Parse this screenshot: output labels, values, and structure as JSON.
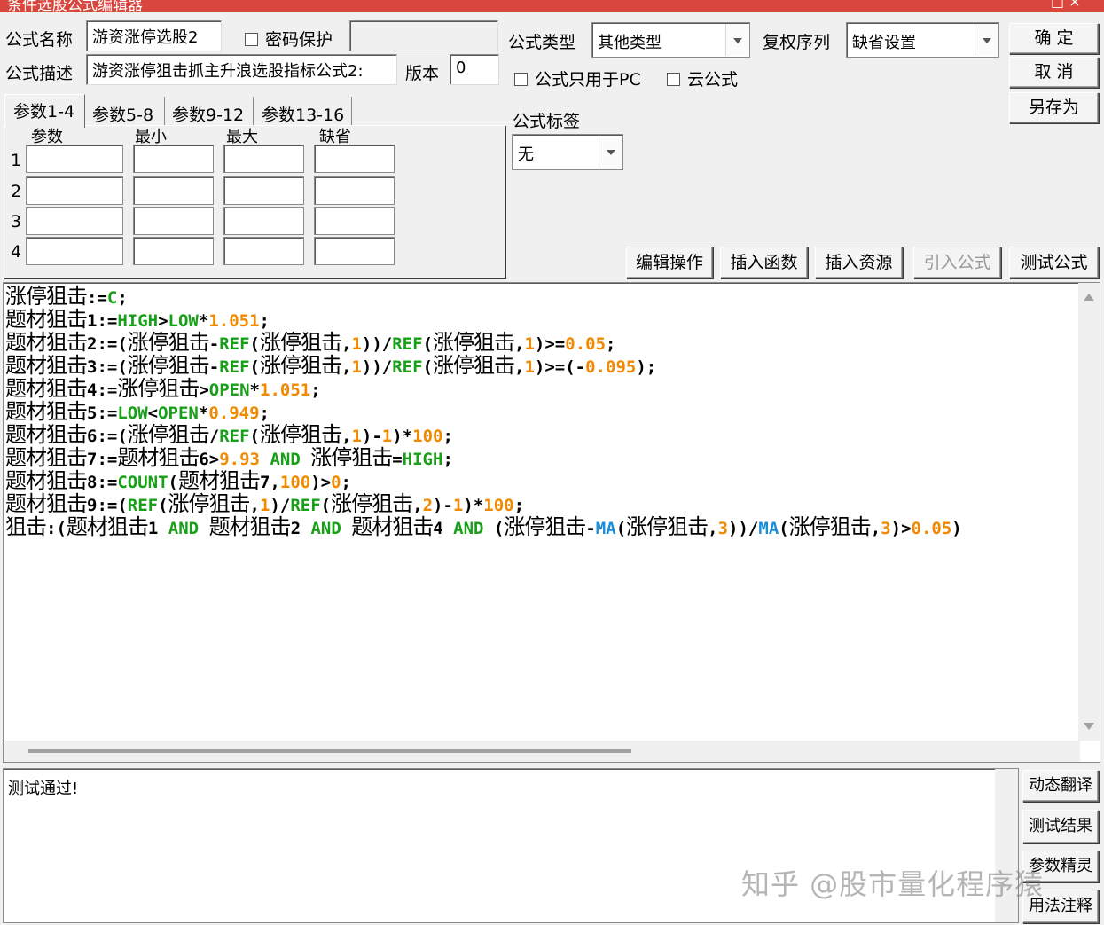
{
  "window": {
    "title": "条件选股公式编辑器",
    "minmax": "□ ×"
  },
  "form": {
    "name_label": "公式名称",
    "name_value": "游资涨停选股2",
    "password_label": "密码保护",
    "password_value": "",
    "desc_label": "公式描述",
    "desc_value": "游资涨停狙击抓主升浪选股指标公式2:",
    "version_label": "版本",
    "version_value": "0",
    "type_label": "公式类型",
    "type_value": "其他类型",
    "rights_label": "复权序列",
    "rights_value": "缺省设置",
    "pc_only_label": "公式只用于PC",
    "cloud_label": "云公式",
    "tag_label": "公式标签",
    "tag_value": "无"
  },
  "buttons": {
    "ok": "确 定",
    "cancel": "取 消",
    "save_as": "另存为",
    "edit_ops": "编辑操作",
    "insert_func": "插入函数",
    "insert_res": "插入资源",
    "import_formula": "引入公式",
    "test_formula": "测试公式"
  },
  "params": {
    "tabs": [
      "参数1-4",
      "参数5-8",
      "参数9-12",
      "参数13-16"
    ],
    "headers": [
      "参数",
      "最小",
      "最大",
      "缺省"
    ],
    "rows": [
      "1",
      "2",
      "3",
      "4"
    ]
  },
  "output": {
    "message": "测试通过!"
  },
  "side_buttons": [
    "动态翻译",
    "测试结果",
    "参数精灵",
    "用法注释"
  ],
  "watermark": "知乎 @股市量化程序猿",
  "code_colors": {
    "keyword": "#18a018",
    "number": "#f08a00",
    "function": "#1a8cd8"
  },
  "code_lines": [
    [
      [
        "cn",
        "涨停狙击"
      ],
      [
        "o",
        ":="
      ],
      [
        "k",
        "C"
      ],
      [
        "o",
        ";"
      ]
    ],
    [
      [
        "cn",
        "题材狙击"
      ],
      [
        "o",
        "1:="
      ],
      [
        "k",
        "HIGH"
      ],
      [
        "o",
        ">"
      ],
      [
        "k",
        "LOW"
      ],
      [
        "o",
        "*"
      ],
      [
        "n",
        "1.051"
      ],
      [
        "o",
        ";"
      ]
    ],
    [
      [
        "cn",
        "题材狙击"
      ],
      [
        "o",
        "2:=("
      ],
      [
        "cn",
        "涨停狙击"
      ],
      [
        "o",
        "-"
      ],
      [
        "k",
        "REF"
      ],
      [
        "o",
        "("
      ],
      [
        "cn",
        "涨停狙击"
      ],
      [
        "o",
        ","
      ],
      [
        "n",
        "1"
      ],
      [
        "o",
        "))/"
      ],
      [
        "k",
        "REF"
      ],
      [
        "o",
        "("
      ],
      [
        "cn",
        "涨停狙击"
      ],
      [
        "o",
        ","
      ],
      [
        "n",
        "1"
      ],
      [
        "o",
        ")>="
      ],
      [
        "n",
        "0.05"
      ],
      [
        "o",
        ";"
      ]
    ],
    [
      [
        "cn",
        "题材狙击"
      ],
      [
        "o",
        "3:=("
      ],
      [
        "cn",
        "涨停狙击"
      ],
      [
        "o",
        "-"
      ],
      [
        "k",
        "REF"
      ],
      [
        "o",
        "("
      ],
      [
        "cn",
        "涨停狙击"
      ],
      [
        "o",
        ","
      ],
      [
        "n",
        "1"
      ],
      [
        "o",
        "))/"
      ],
      [
        "k",
        "REF"
      ],
      [
        "o",
        "("
      ],
      [
        "cn",
        "涨停狙击"
      ],
      [
        "o",
        ","
      ],
      [
        "n",
        "1"
      ],
      [
        "o",
        ")>=(-"
      ],
      [
        "n",
        "0.095"
      ],
      [
        "o",
        ");"
      ]
    ],
    [
      [
        "cn",
        "题材狙击"
      ],
      [
        "o",
        "4:="
      ],
      [
        "cn",
        "涨停狙击"
      ],
      [
        "o",
        ">"
      ],
      [
        "k",
        "OPEN"
      ],
      [
        "o",
        "*"
      ],
      [
        "n",
        "1.051"
      ],
      [
        "o",
        ";"
      ]
    ],
    [
      [
        "cn",
        "题材狙击"
      ],
      [
        "o",
        "5:="
      ],
      [
        "k",
        "LOW"
      ],
      [
        "o",
        "<"
      ],
      [
        "k",
        "OPEN"
      ],
      [
        "o",
        "*"
      ],
      [
        "n",
        "0.949"
      ],
      [
        "o",
        ";"
      ]
    ],
    [
      [
        "cn",
        "题材狙击"
      ],
      [
        "o",
        "6:=("
      ],
      [
        "cn",
        "涨停狙击"
      ],
      [
        "o",
        "/"
      ],
      [
        "k",
        "REF"
      ],
      [
        "o",
        "("
      ],
      [
        "cn",
        "涨停狙击"
      ],
      [
        "o",
        ","
      ],
      [
        "n",
        "1"
      ],
      [
        "o",
        ")-"
      ],
      [
        "n",
        "1"
      ],
      [
        "o",
        ")*"
      ],
      [
        "n",
        "100"
      ],
      [
        "o",
        ";"
      ]
    ],
    [
      [
        "cn",
        "题材狙击"
      ],
      [
        "o",
        "7:="
      ],
      [
        "cn",
        "题材狙击"
      ],
      [
        "o",
        "6>"
      ],
      [
        "n",
        "9.93"
      ],
      [
        "o",
        " "
      ],
      [
        "k",
        "AND"
      ],
      [
        "o",
        " "
      ],
      [
        "cn",
        "涨停狙击"
      ],
      [
        "o",
        "="
      ],
      [
        "k",
        "HIGH"
      ],
      [
        "o",
        ";"
      ]
    ],
    [
      [
        "cn",
        "题材狙击"
      ],
      [
        "o",
        "8:="
      ],
      [
        "k",
        "COUNT"
      ],
      [
        "o",
        "("
      ],
      [
        "cn",
        "题材狙击"
      ],
      [
        "o",
        "7,"
      ],
      [
        "n",
        "100"
      ],
      [
        "o",
        ")>"
      ],
      [
        "n",
        "0"
      ],
      [
        "o",
        ";"
      ]
    ],
    [
      [
        "cn",
        "题材狙击"
      ],
      [
        "o",
        "9:=("
      ],
      [
        "k",
        "REF"
      ],
      [
        "o",
        "("
      ],
      [
        "cn",
        "涨停狙击"
      ],
      [
        "o",
        ","
      ],
      [
        "n",
        "1"
      ],
      [
        "o",
        ")/"
      ],
      [
        "k",
        "REF"
      ],
      [
        "o",
        "("
      ],
      [
        "cn",
        "涨停狙击"
      ],
      [
        "o",
        ","
      ],
      [
        "n",
        "2"
      ],
      [
        "o",
        ")-"
      ],
      [
        "n",
        "1"
      ],
      [
        "o",
        ")*"
      ],
      [
        "n",
        "100"
      ],
      [
        "o",
        ";"
      ]
    ],
    [
      [
        "cn",
        "狙击"
      ],
      [
        "o",
        ":("
      ],
      [
        "cn",
        "题材狙击"
      ],
      [
        "o",
        "1 "
      ],
      [
        "k",
        "AND"
      ],
      [
        "o",
        " "
      ],
      [
        "cn",
        "题材狙击"
      ],
      [
        "o",
        "2 "
      ],
      [
        "k",
        "AND"
      ],
      [
        "o",
        " "
      ],
      [
        "cn",
        "题材狙击"
      ],
      [
        "o",
        "4 "
      ],
      [
        "k",
        "AND"
      ],
      [
        "o",
        " ("
      ],
      [
        "cn",
        "涨停狙击"
      ],
      [
        "o",
        "-"
      ],
      [
        "f",
        "MA"
      ],
      [
        "o",
        "("
      ],
      [
        "cn",
        "涨停狙击"
      ],
      [
        "o",
        ","
      ],
      [
        "n",
        "3"
      ],
      [
        "o",
        "))/"
      ],
      [
        "f",
        "MA"
      ],
      [
        "o",
        "("
      ],
      [
        "cn",
        "涨停狙击"
      ],
      [
        "o",
        ","
      ],
      [
        "n",
        "3"
      ],
      [
        "o",
        ")>"
      ],
      [
        "n",
        "0.05"
      ],
      [
        "o",
        ")"
      ]
    ]
  ]
}
